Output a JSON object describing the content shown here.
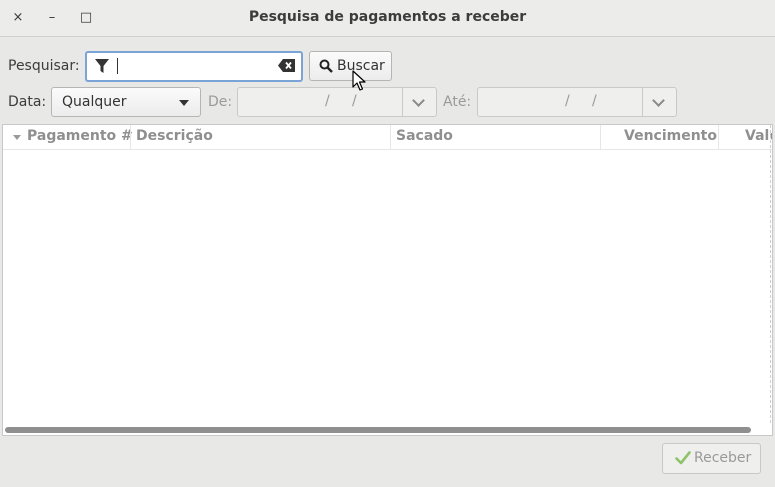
{
  "window": {
    "title": "Pesquisa de pagamentos a receber",
    "controls": {
      "close": "×",
      "minimize": "–",
      "maximize": "□"
    }
  },
  "search": {
    "label": "Pesquisar:",
    "value": "",
    "placeholder": "",
    "button_label": "Buscar"
  },
  "date_filter": {
    "label": "Data:",
    "selected": "Qualquer",
    "from_label": "De:",
    "to_label": "Até:",
    "from_value": {
      "day": "",
      "month": "",
      "year": ""
    },
    "to_value": {
      "day": "",
      "month": "",
      "year": ""
    },
    "separator": "/"
  },
  "table": {
    "columns": [
      "Pagamento #",
      "Descrição",
      "Sacado",
      "Vencimento",
      "Valo"
    ],
    "rows": []
  },
  "footer": {
    "receber_label": "Receber"
  },
  "colors": {
    "focus_border": "#7aa3d6",
    "check_icon": "#8fc26a"
  },
  "icons": [
    "filter-icon",
    "clear-text-icon",
    "search-icon",
    "check-icon",
    "sort-desc-icon"
  ]
}
